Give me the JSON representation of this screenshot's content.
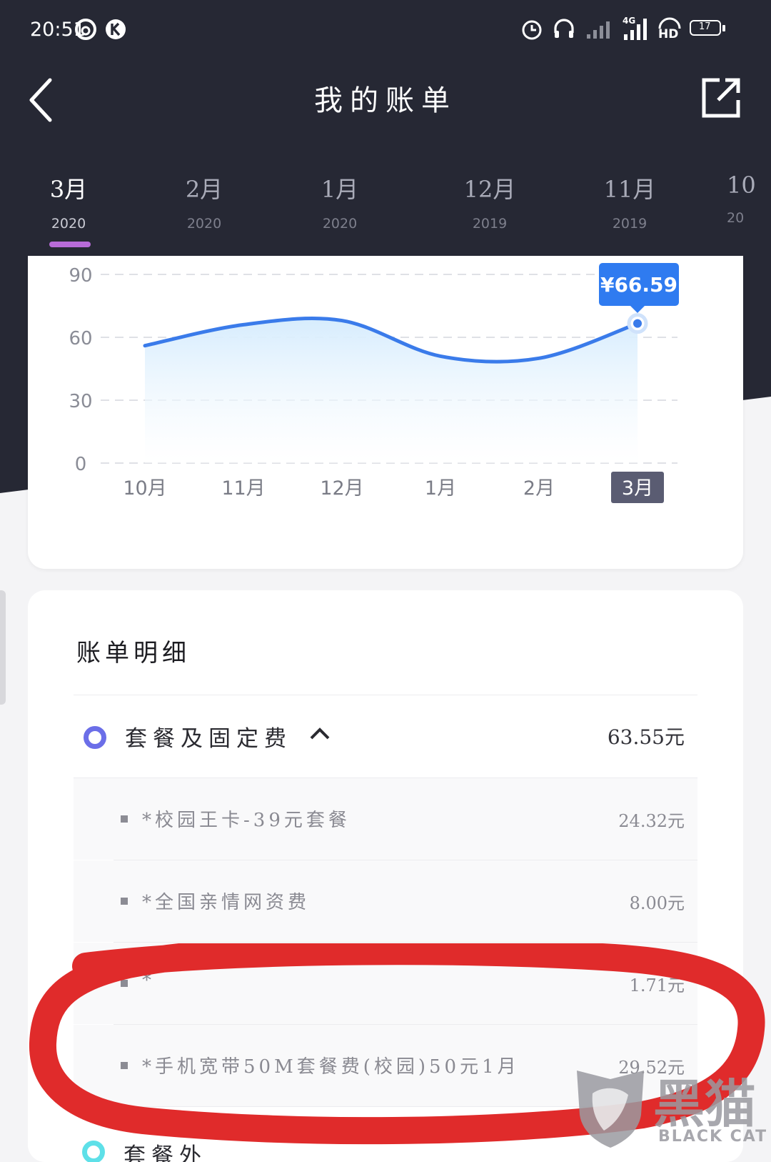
{
  "status_bar": {
    "time": "20:51",
    "network": "4G",
    "hd": "HD",
    "battery": "17",
    "icons": [
      "netease-music-icon",
      "k-app-icon",
      "alarm-icon",
      "headset-icon",
      "signal-icon",
      "signal-4g-icon",
      "hd-icon",
      "battery-icon"
    ]
  },
  "header": {
    "title": "我的账单",
    "back_icon": "back-arrow-icon",
    "share_icon": "share-icon"
  },
  "month_tabs": [
    {
      "month": "3月",
      "year": "2020",
      "active": true
    },
    {
      "month": "2月",
      "year": "2020",
      "active": false
    },
    {
      "month": "1月",
      "year": "2020",
      "active": false
    },
    {
      "month": "12月",
      "year": "2019",
      "active": false
    },
    {
      "month": "11月",
      "year": "2019",
      "active": false
    },
    {
      "month": "10",
      "year": "20",
      "active": false
    }
  ],
  "chart_data": {
    "type": "area",
    "categories": [
      "10月",
      "11月",
      "12月",
      "1月",
      "2月",
      "3月"
    ],
    "values": [
      56,
      66,
      68,
      51,
      50,
      66.59
    ],
    "y_ticks": [
      90,
      60,
      30,
      0
    ],
    "ylim": [
      0,
      90
    ],
    "selected_index": 5,
    "tooltip": "¥66.59",
    "grid": true,
    "line_color": "#3a7bea",
    "fill_color": "#d6ecfd",
    "selected_color": "#5a5c72"
  },
  "details": {
    "title": "账单明细",
    "category": {
      "label": "套餐及固定费",
      "amount": "63.55元",
      "dot_color": "#6b6ee8"
    },
    "items": [
      {
        "label": "*校园王卡-39元套餐",
        "amount": "24.32元"
      },
      {
        "label": "*全国亲情网资费",
        "amount": "8.00元"
      },
      {
        "label": "*",
        "amount": "1.71元"
      },
      {
        "label": "*手机宽带50M套餐费(校园)50元1月",
        "amount": "29.52元"
      }
    ],
    "next_category": {
      "label": "套餐外",
      "dot_color": "#5ee0e8"
    }
  },
  "annotation": {
    "color": "#e02b2b"
  },
  "watermark": {
    "text": "黑猫",
    "sub": "BLACK CAT"
  }
}
